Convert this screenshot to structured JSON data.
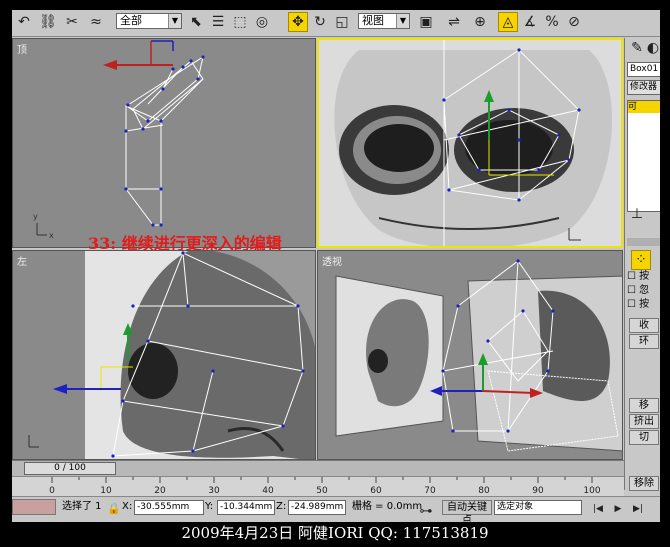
{
  "toolbar": {
    "filter_select": "全部",
    "coord_select": "视图",
    "icons": [
      "undo-icon",
      "redo-icon",
      "link-icon",
      "unlink-icon",
      "bind-icon",
      "select-icon",
      "select-by-name-icon",
      "region-select-icon",
      "window-crossing-icon",
      "move-icon",
      "rotate-icon",
      "scale-icon",
      "pivot-icon",
      "mirror-icon",
      "align-icon",
      "snap-icon",
      "angle-snap-icon",
      "percent-snap-icon"
    ]
  },
  "viewports": {
    "top": {
      "label": "顶"
    },
    "front": {
      "label": ""
    },
    "left": {
      "label": "左"
    },
    "perspective": {
      "label": "透视"
    }
  },
  "annotation": "33: 继续进行更深入的编辑",
  "command_panel": {
    "object_name": "Box01",
    "modifier_list": "修改器",
    "stack_item": "可",
    "checks": [
      "按",
      "忽",
      "按"
    ],
    "buttons": [
      "收",
      "环",
      "移",
      "挤出",
      "切",
      "移除"
    ]
  },
  "timeline": {
    "frame_display": "0 / 100"
  },
  "ruler": {
    "ticks": [
      "0",
      "10",
      "20",
      "30",
      "40",
      "50",
      "60",
      "70",
      "80",
      "90",
      "100"
    ]
  },
  "status": {
    "selection": "选择了 1",
    "x_label": "X:",
    "x_value": "-30.555mm",
    "y_label": "Y:",
    "y_value": "-10.344mm",
    "z_label": "Z:",
    "z_value": "-24.989mm",
    "grid_text": "栅格 = 0.0mm",
    "auto_key": "自动关键点",
    "key_filter": "选定对象"
  },
  "caption": "2009年4月23日  阿健IORI QQ: 117513819",
  "colors": {
    "active_viewport": "#f2e400",
    "annotation": "#e21b1b",
    "wire": "#2020c0"
  }
}
